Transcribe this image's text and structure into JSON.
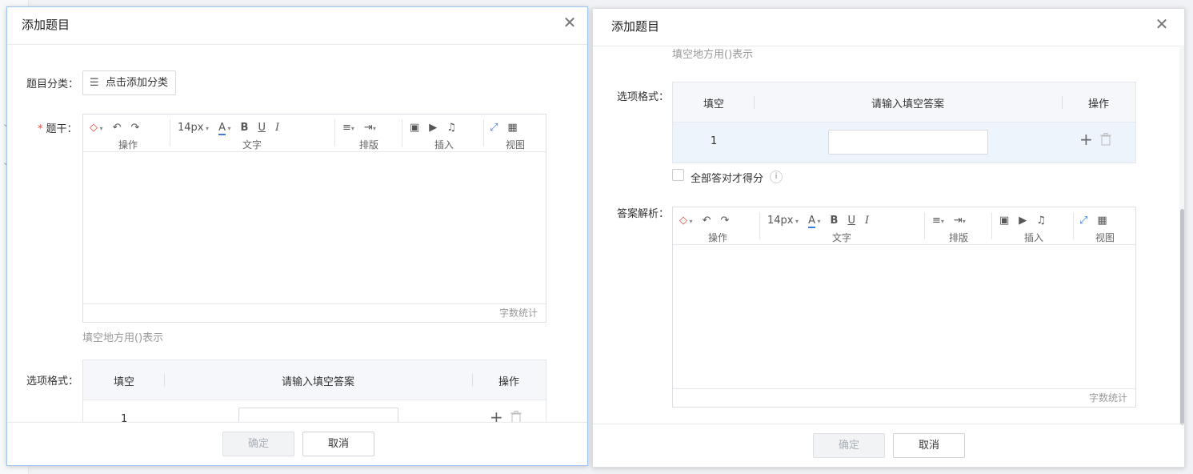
{
  "left_dialog": {
    "title": "添加题目",
    "category": {
      "label": "题目分类：",
      "button": "点击添加分类"
    },
    "stem": {
      "required_mark": "*",
      "label": "题干："
    },
    "editor": {
      "font_size": "14px",
      "groups": [
        "操作",
        "文字",
        "排版",
        "插入",
        "视图"
      ],
      "word_count": "字数统计"
    },
    "hint": "填空地方用()表示",
    "options": {
      "label": "选项格式：",
      "headers": [
        "填空",
        "请输入填空答案",
        "操作"
      ],
      "rows": [
        {
          "num": "1",
          "value": ""
        }
      ]
    },
    "footer": {
      "confirm": "确定",
      "cancel": "取消"
    }
  },
  "right_dialog": {
    "title": "添加题目",
    "hint": "填空地方用()表示",
    "options": {
      "label": "选项格式：",
      "headers": [
        "填空",
        "请输入填空答案",
        "操作"
      ],
      "rows": [
        {
          "num": "1",
          "value": ""
        }
      ]
    },
    "all_correct_label": "全部答对才得分",
    "analysis": {
      "label": "答案解析：",
      "font_size": "14px",
      "groups": [
        "操作",
        "文字",
        "排版",
        "插入",
        "视图"
      ],
      "word_count": "字数统计"
    },
    "footer": {
      "confirm": "确定",
      "cancel": "取消"
    }
  },
  "colors": {
    "accent_blue": "#3b7ddd",
    "eraser_red": "#e2483b",
    "required_red": "#e84c3d",
    "row_highlight": "#eef4fc"
  }
}
